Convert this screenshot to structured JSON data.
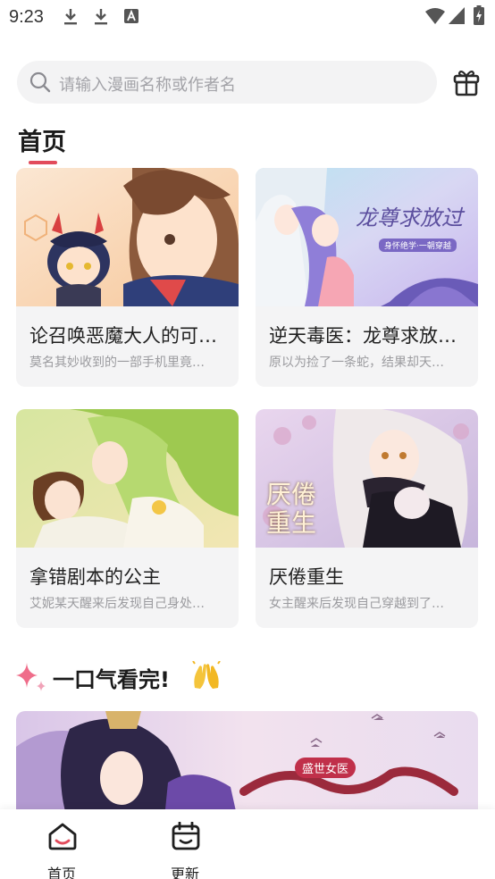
{
  "status_bar": {
    "time": "9:23",
    "left_icons": [
      "download-icon",
      "download-icon",
      "text-a-icon"
    ],
    "right_icons": [
      "wifi-icon",
      "signal-icon",
      "battery-charging-icon"
    ]
  },
  "search": {
    "placeholder": "请输入漫画名称或作者名",
    "icon": "search-icon"
  },
  "header": {
    "gift_icon": "gift-icon"
  },
  "page_title": "首页",
  "accent_color": "#e24b5b",
  "comics": [
    {
      "title": "论召唤恶魔大人的可…",
      "desc": "莫名其妙收到的一部手机里竟…"
    },
    {
      "title": "逆天毒医：龙尊求放…",
      "desc": "原以为捡了一条蛇，结果却天…"
    },
    {
      "title": "拿错剧本的公主",
      "desc": "艾妮某天醒来后发现自己身处…"
    },
    {
      "title": "厌倦重生",
      "desc": "女主醒来后发现自己穿越到了…"
    }
  ],
  "covers": {
    "c2_title_art": "龙尊求放过",
    "c2_sub_art": "身怀绝学·一朝穿越",
    "c4_title_art": "厌倦重生",
    "banner_badge_art": "盛世女医"
  },
  "section2": {
    "title": "一口气看完!",
    "icons": [
      "sparkle-icon",
      "clap-hands-icon"
    ]
  },
  "bottom_nav": [
    {
      "label": "首页",
      "icon": "home-icon",
      "active": true
    },
    {
      "label": "更新",
      "icon": "calendar-icon",
      "active": false
    }
  ]
}
